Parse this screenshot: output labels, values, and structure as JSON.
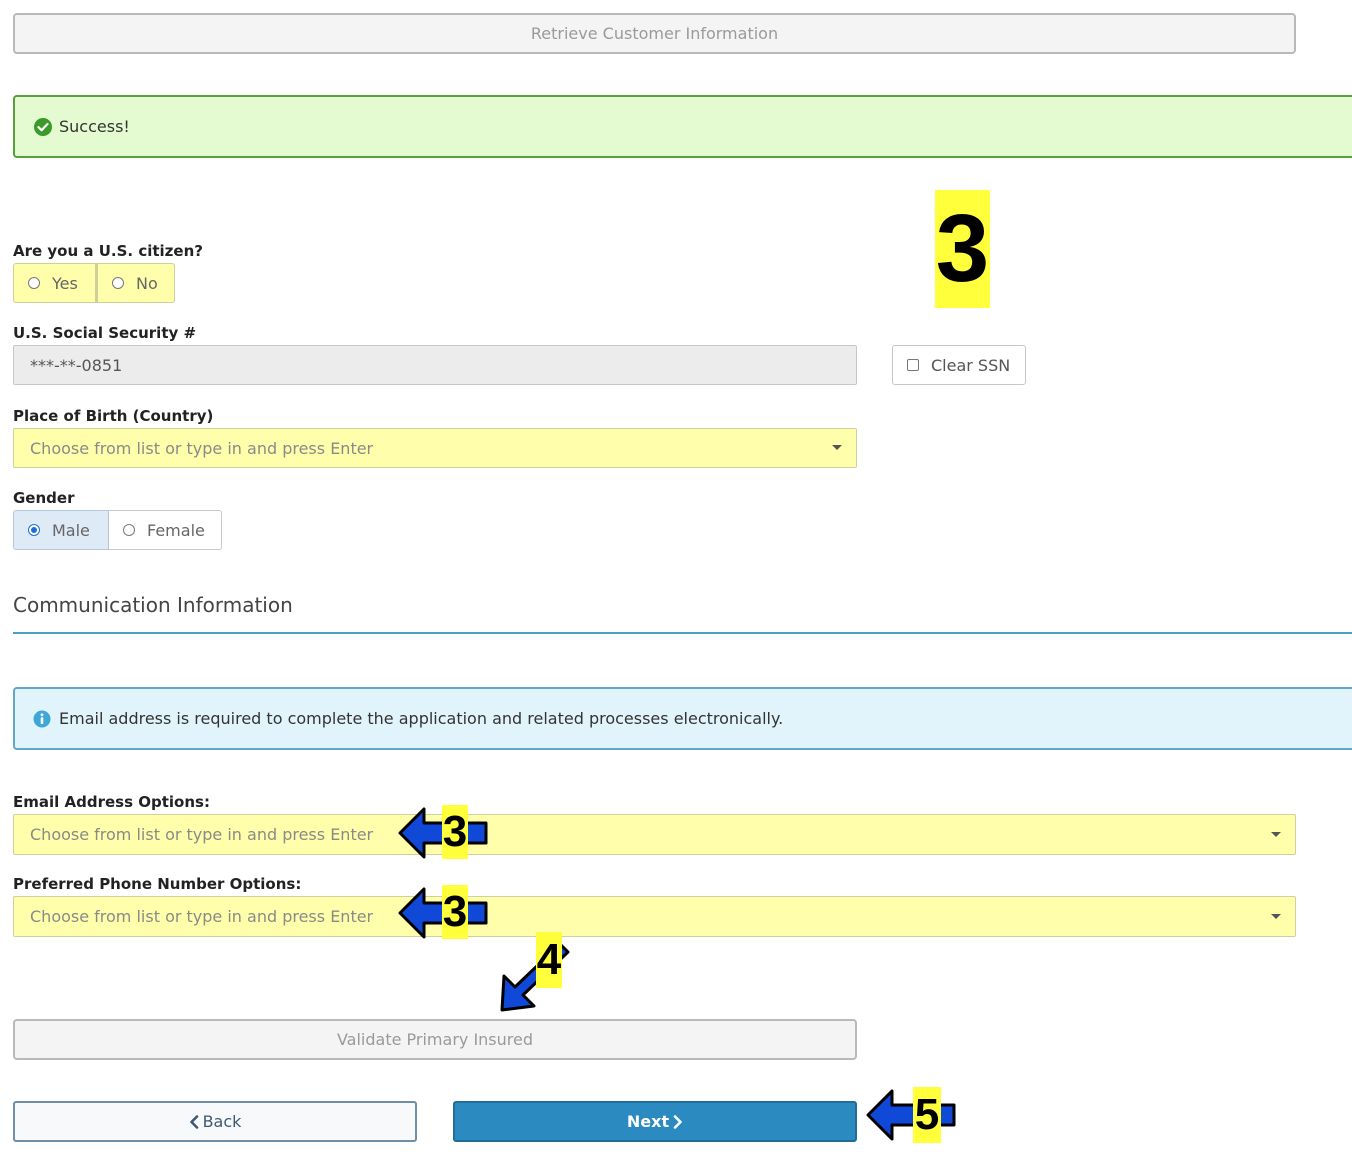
{
  "top": {
    "retrieve_button": "Retrieve Customer Information"
  },
  "success_alert": {
    "text": "Success!"
  },
  "citizen": {
    "label": "Are you a U.S. citizen?",
    "options": [
      "Yes",
      "No"
    ]
  },
  "ssn": {
    "label": "U.S. Social Security #",
    "value": "***-**-0851",
    "clear_label": "Clear SSN"
  },
  "birth": {
    "label": "Place of Birth (Country)",
    "placeholder": "Choose from list or type in and press Enter"
  },
  "gender": {
    "label": "Gender",
    "options": [
      "Male",
      "Female"
    ],
    "selected": "Male"
  },
  "communication": {
    "title": "Communication Information"
  },
  "info_alert": {
    "text": "Email address is required to complete the application and related processes electronically."
  },
  "email": {
    "label": "Email Address Options:",
    "placeholder": "Choose from list or type in and press Enter"
  },
  "phone": {
    "label": "Preferred Phone Number Options:",
    "placeholder": "Choose from list or type in and press Enter"
  },
  "validate": {
    "label": "Validate Primary Insured"
  },
  "nav": {
    "back_label": "Back",
    "next_label": "Next"
  },
  "annotations": {
    "step_big": "3",
    "email_step": "3",
    "phone_step": "3",
    "validate_step": "4",
    "next_step": "5"
  },
  "colors": {
    "highlight_yellow": "#ffff3b",
    "arrow_blue": "#1048d8",
    "next_blue": "#2b8bc0",
    "success_green": "#3b9a2a",
    "info_blue": "#3ea6d8"
  }
}
